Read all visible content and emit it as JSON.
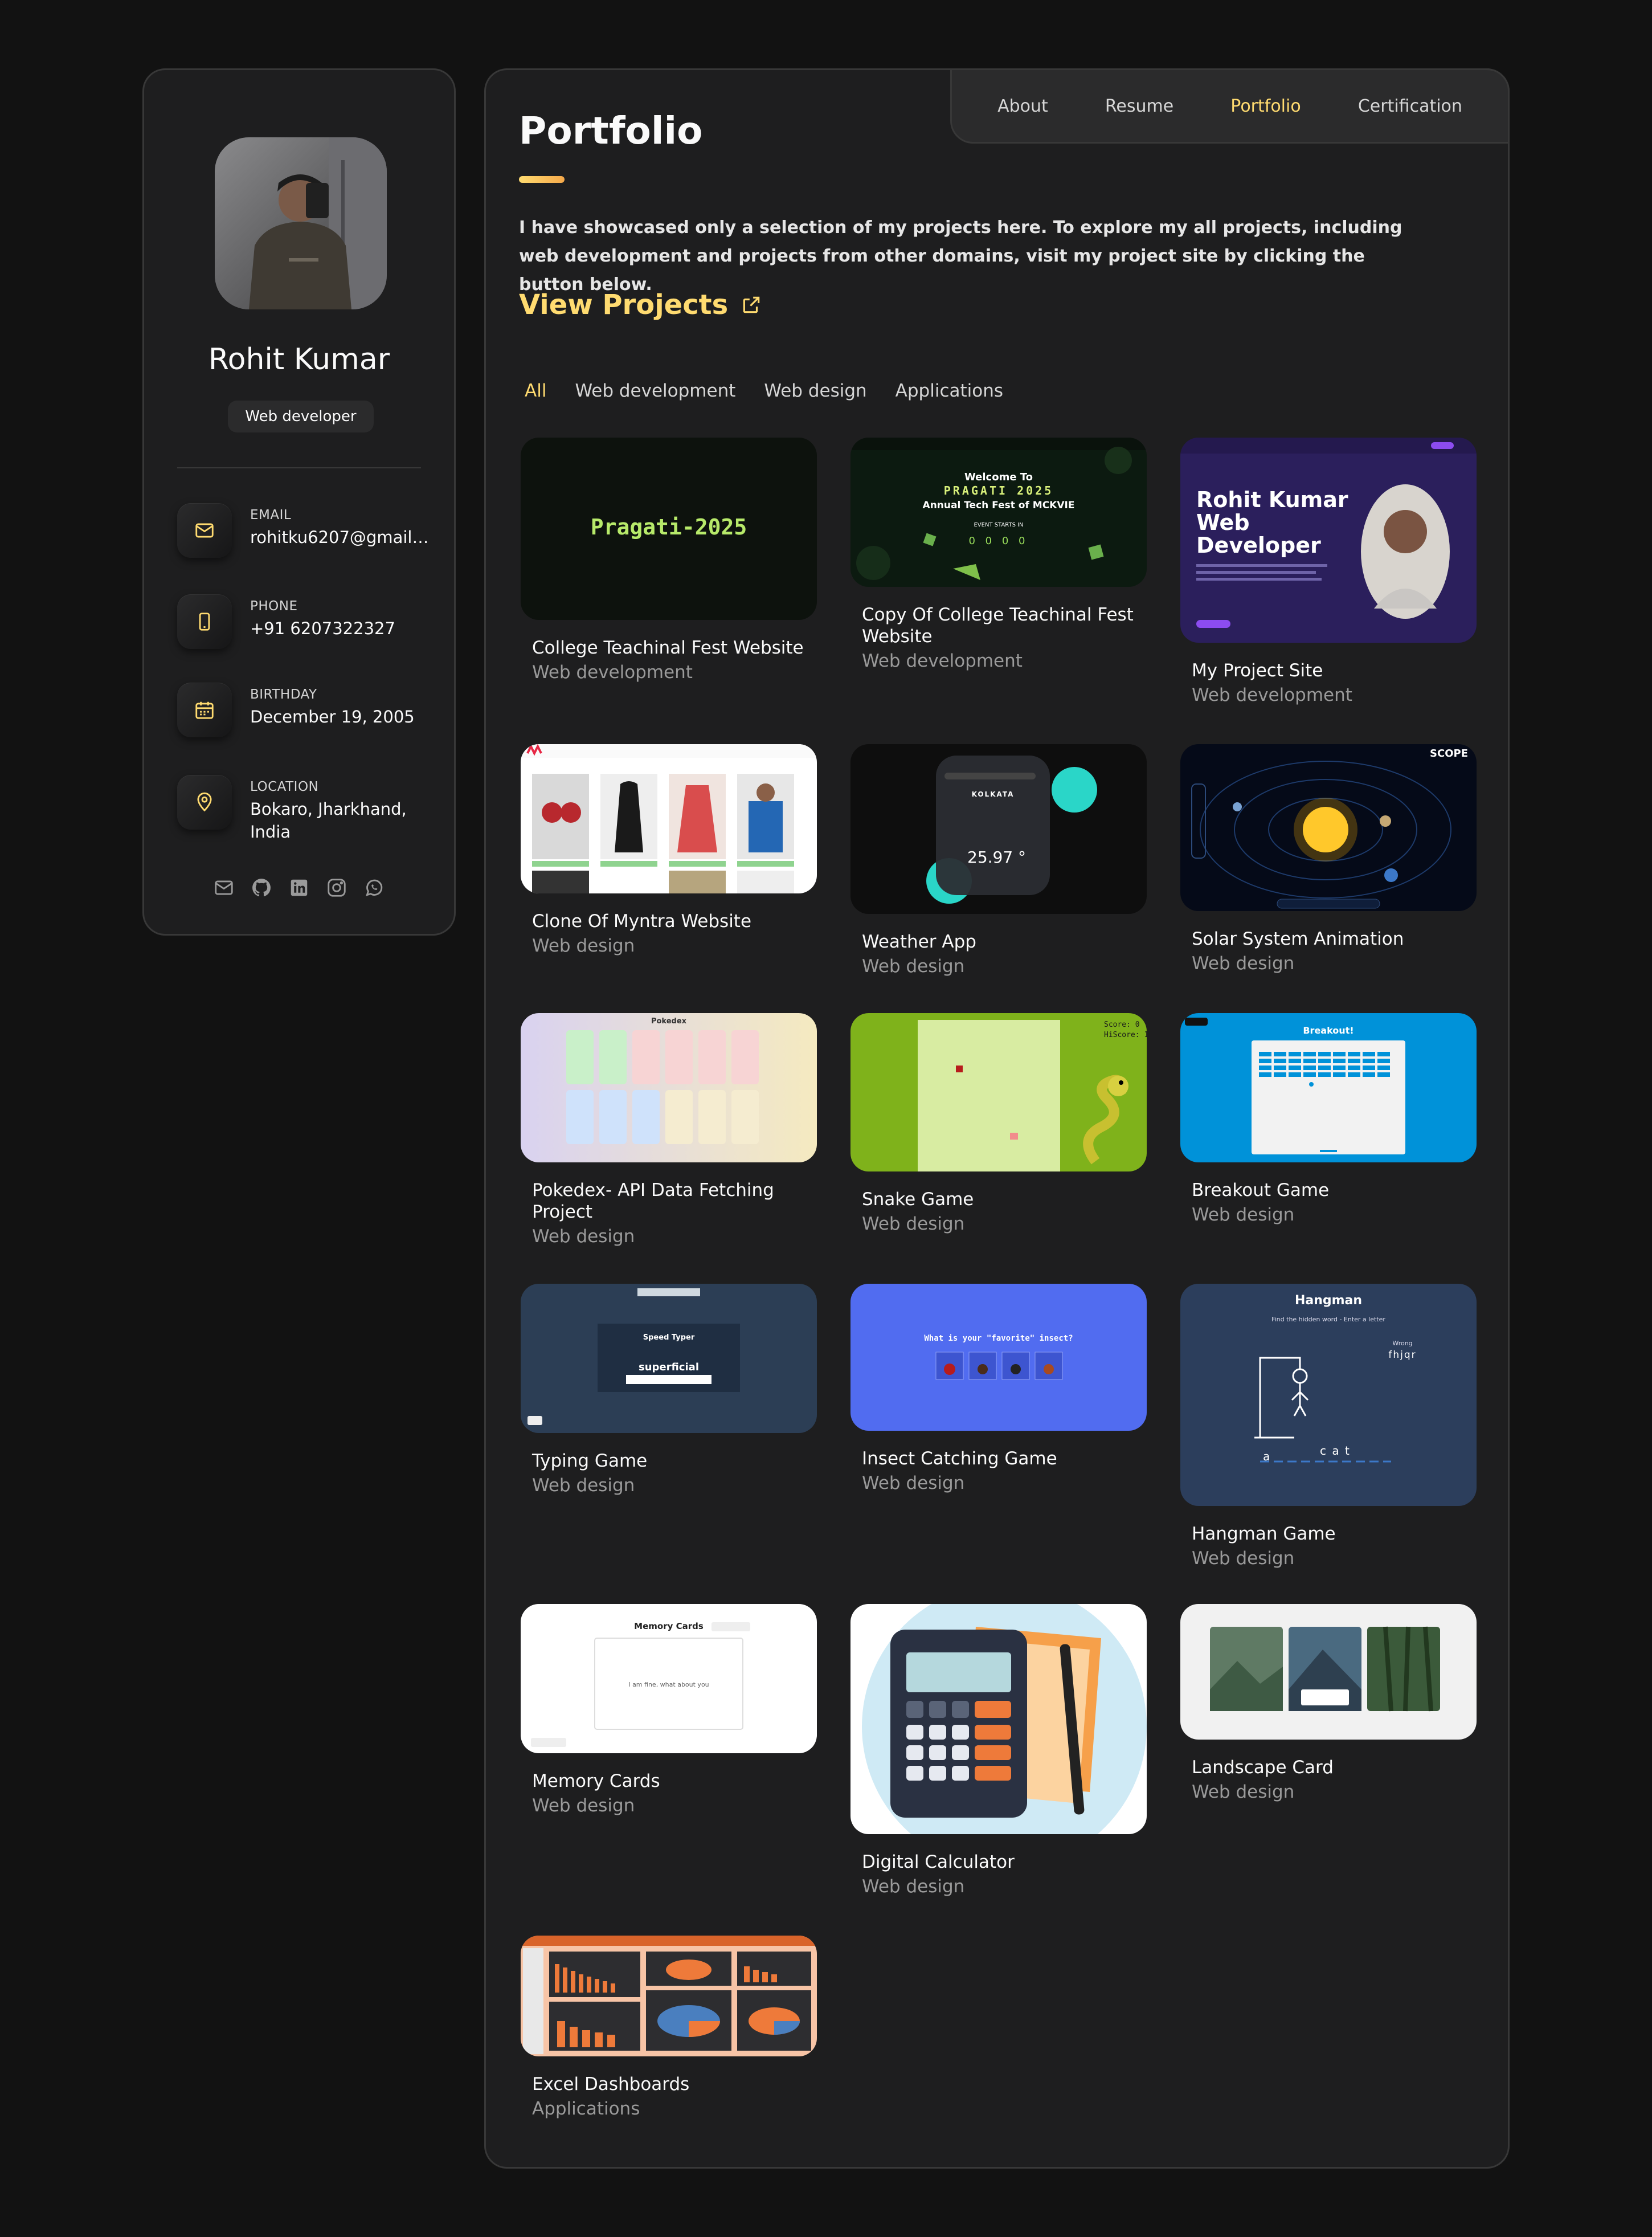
{
  "profile": {
    "name": "Rohit Kumar",
    "role": "Web developer",
    "contacts": [
      {
        "title": "EMAIL",
        "value": "rohitku6207@gmail…",
        "icon": "mail-icon"
      },
      {
        "title": "PHONE",
        "value": "+91 6207322327",
        "icon": "phone-icon"
      },
      {
        "title": "BIRTHDAY",
        "value": "December 19, 2005",
        "icon": "calendar-icon"
      },
      {
        "title": "LOCATION",
        "value": "Bokaro, Jharkhand, India",
        "icon": "location-icon"
      }
    ],
    "socials": [
      "mail-icon",
      "github-icon",
      "linkedin-icon",
      "instagram-icon",
      "whatsapp-icon"
    ]
  },
  "nav": {
    "items": [
      "About",
      "Resume",
      "Portfolio",
      "Certification"
    ],
    "active": "Portfolio"
  },
  "portfolio": {
    "title": "Portfolio",
    "intro": "I have showcased only a selection of my projects here. To explore my all projects, including web development and projects from other domains, visit my project site by clicking the button below.",
    "view_projects": "View Projects",
    "filters": [
      "All",
      "Web development",
      "Web design",
      "Applications"
    ],
    "active_filter": "All"
  },
  "projects": [
    {
      "title": "College Teachinal Fest Website",
      "category": "Web development",
      "thumb_text": "Pragati-2025"
    },
    {
      "title": "Copy Of College Teachinal Fest Website",
      "category": "Web development",
      "thumb_text": [
        "Welcome To",
        "PRAGATI 2025",
        "Annual Tech Fest of MCKVIE",
        "EVENT STARTS IN",
        "0 0 0 0"
      ]
    },
    {
      "title": "My Project Site",
      "category": "Web development",
      "thumb_text": [
        "Rohit Kumar",
        "Web",
        "Developer"
      ]
    },
    {
      "title": "Clone Of Myntra Website",
      "category": "Web design"
    },
    {
      "title": "Weather App",
      "category": "Web design",
      "thumb_text": [
        "KOLKATA",
        "25.97 °"
      ]
    },
    {
      "title": "Solar System Animation",
      "category": "Web design",
      "thumb_text": "SCOPE"
    },
    {
      "title": "Pokedex- API Data Fetching Project",
      "category": "Web design",
      "thumb_text": "Pokedex"
    },
    {
      "title": "Snake Game",
      "category": "Web design",
      "thumb_text": [
        "Score: 0",
        "HiScore: 1"
      ]
    },
    {
      "title": "Breakout Game",
      "category": "Web design",
      "thumb_text": "Breakout!"
    },
    {
      "title": "Typing Game",
      "category": "Web design",
      "thumb_text": [
        "Speed Typer",
        "superficial"
      ]
    },
    {
      "title": "Insect Catching Game",
      "category": "Web design",
      "thumb_text": "What is your \"favorite\" insect?"
    },
    {
      "title": "Hangman Game",
      "category": "Web design",
      "thumb_text": [
        "Hangman",
        "Find the hidden word - Enter a letter",
        "Wrong",
        "fhjqr",
        "a",
        "c a t"
      ]
    },
    {
      "title": "Memory Cards",
      "category": "Web design",
      "thumb_text": [
        "Memory Cards",
        "I am fine, what about you"
      ]
    },
    {
      "title": "Digital Calculator",
      "category": "Web design"
    },
    {
      "title": "Landscape Card",
      "category": "Web design"
    },
    {
      "title": "Excel Dashboards",
      "category": "Applications"
    }
  ],
  "colors": {
    "accent": "#ffdb70",
    "background": "#121212",
    "card": "#1e1e1f"
  }
}
